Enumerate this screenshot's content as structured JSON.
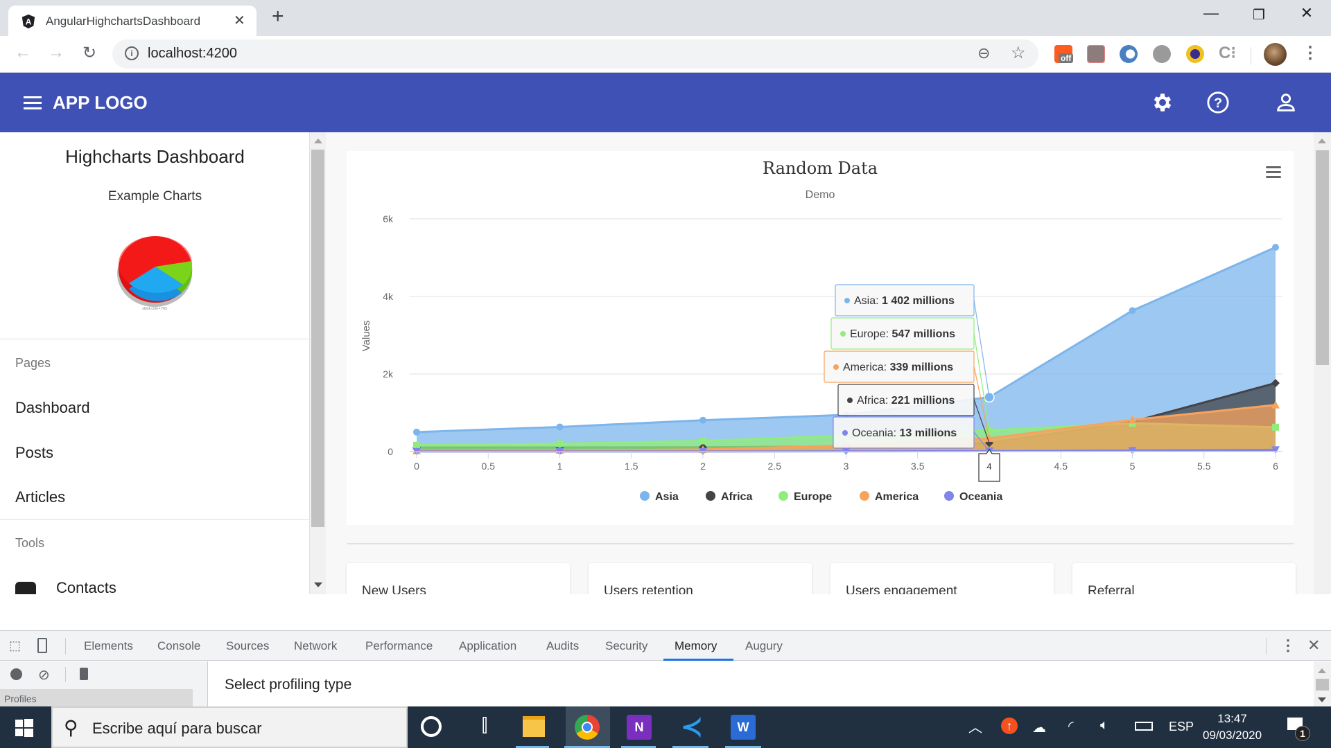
{
  "browser": {
    "tab_title": "AngularHighchartsDashboard",
    "url": "localhost:4200",
    "extensions": [
      "coupon-extension-icon",
      "pdf-extension-icon",
      "blue-ring-extension-icon",
      "tomato-timer-extension-icon",
      "moon-extension-icon",
      "c-dots-extension-icon"
    ],
    "extension_badge": "off"
  },
  "app": {
    "logo": "APP LOGO",
    "toolbar_icons": [
      "settings-icon",
      "help-icon",
      "account-icon"
    ],
    "brand_color": "#3f51b5"
  },
  "sidebar": {
    "title": "Highcharts Dashboard",
    "subtitle": "Example Charts",
    "image_caption": "stock.com • 763",
    "sections": [
      {
        "label": "Pages",
        "items": [
          {
            "label": "Dashboard"
          },
          {
            "label": "Posts"
          },
          {
            "label": "Articles"
          }
        ]
      },
      {
        "label": "Tools",
        "items": [
          {
            "label": "Contacts",
            "icon": "contacts-book-icon"
          }
        ]
      }
    ]
  },
  "cards": [
    {
      "title": "New Users"
    },
    {
      "title": "Users retention"
    },
    {
      "title": "Users engagement"
    },
    {
      "title": "Referral"
    }
  ],
  "tooltip": {
    "x": "4",
    "rows": [
      {
        "series": "Asia",
        "value": "1 402 millions"
      },
      {
        "series": "Europe",
        "value": "547 millions"
      },
      {
        "series": "America",
        "value": "339 millions"
      },
      {
        "series": "Africa",
        "value": "221 millions"
      },
      {
        "series": "Oceania",
        "value": "13 millions"
      }
    ]
  },
  "chart_data": {
    "type": "area",
    "title": "Random Data",
    "subtitle": "Demo",
    "xlabel": "",
    "ylabel": "Values",
    "x": [
      0,
      1,
      2,
      3,
      4,
      5,
      6
    ],
    "xticks": [
      "0",
      "0.5",
      "1",
      "1.5",
      "2",
      "2.5",
      "3",
      "3.5",
      "4",
      "4.5",
      "5",
      "5.5",
      "6"
    ],
    "xlim": [
      0,
      6
    ],
    "yticks": [
      "0",
      "2k",
      "4k",
      "6k"
    ],
    "ylim": [
      0,
      6000
    ],
    "grid": true,
    "legend_position": "bottom-center",
    "series": [
      {
        "name": "Asia",
        "color": "#7cb5ec",
        "marker": "circle",
        "values": [
          502,
          635,
          809,
          947,
          1402,
          3634,
          5268
        ]
      },
      {
        "name": "Africa",
        "color": "#434348",
        "marker": "diamond",
        "values": [
          106,
          107,
          111,
          133,
          221,
          767,
          1766
        ]
      },
      {
        "name": "Europe",
        "color": "#90ed7d",
        "marker": "square",
        "values": [
          163,
          203,
          276,
          408,
          547,
          729,
          628
        ]
      },
      {
        "name": "America",
        "color": "#f7a35c",
        "marker": "triangle",
        "values": [
          18,
          31,
          54,
          156,
          339,
          818,
          1201
        ]
      },
      {
        "name": "Oceania",
        "color": "#8085e9",
        "marker": "triangle-down",
        "values": [
          2,
          2,
          2,
          6,
          13,
          30,
          46
        ]
      }
    ]
  },
  "devtools": {
    "tabs": [
      "Elements",
      "Console",
      "Sources",
      "Network",
      "Performance",
      "Application",
      "Audits",
      "Security",
      "Memory",
      "Augury"
    ],
    "active_tab": "Memory",
    "main_text": "Select profiling type",
    "left_panel_label": "Profiles"
  },
  "taskbar": {
    "search_placeholder": "Escribe aquí para buscar",
    "language": "ESP",
    "time": "13:47",
    "date": "09/03/2020",
    "notification_count": "1",
    "pinned_apps": [
      "cortana-icon",
      "task-view-icon",
      "file-explorer-icon",
      "chrome-icon",
      "onenote-icon",
      "vscode-icon",
      "word-icon"
    ]
  }
}
